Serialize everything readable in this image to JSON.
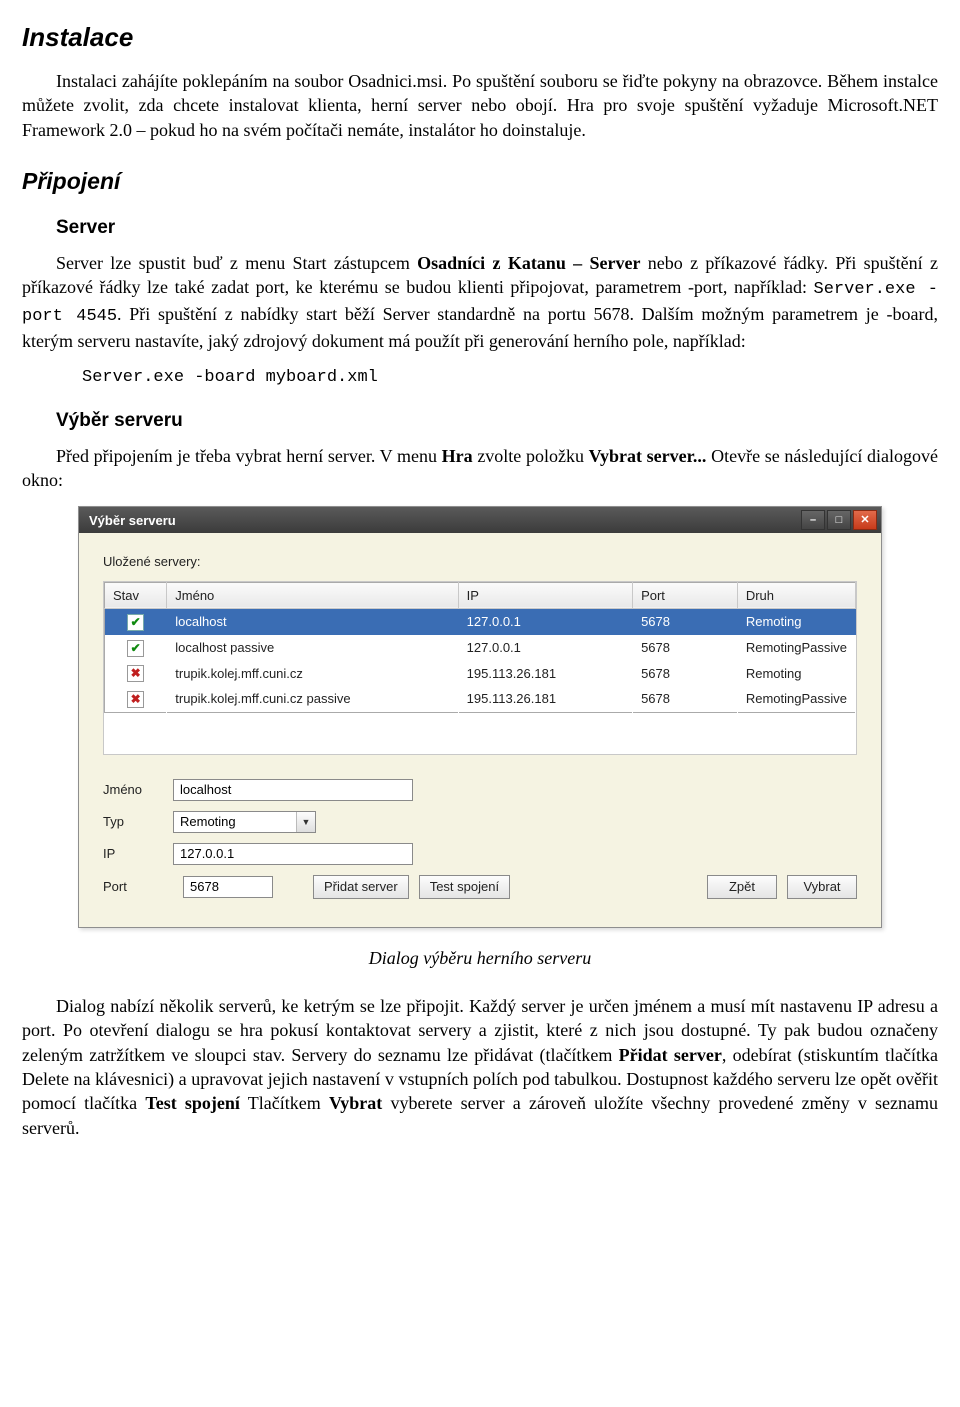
{
  "doc": {
    "h_instalace": "Instalace",
    "p_instalace_1a": "Instalaci zahájíte poklepáním na soubor Osadnici.msi. Po spuštění souboru se řiďte pokyny na obrazovce. Během instalce můžete zvolit, zda chcete instalovat klienta, herní server nebo obojí. Hra pro svoje spuštění vyžaduje Microsoft.NET Framework 2.0 – pokud ho na svém počítači nemáte, instalátor ho doinstaluje.",
    "h_pripojeni": "Připojení",
    "h_server": "Server",
    "p_server_1a": "Server lze spustit buď z menu Start zástupcem ",
    "p_server_bold1": "Osadníci z Katanu – Server",
    "p_server_1b": " nebo z příkazové řádky. Při spuštění z příkazové řádky lze také zadat port, ke kterému se budou klienti připojovat, parametrem -port, například: ",
    "p_server_code1": "Server.exe -port 4545",
    "p_server_1c": ". Při spuštění z nabídky start běží Server standardně na portu 5678. Dalším možným parametrem je -board, kterým serveru nastavíte, jaký zdrojový dokument má použít při generování herního pole, například:",
    "codeblock1": "Server.exe -board myboard.xml",
    "h_vyber": "Výběr serveru",
    "p_vyber_1a": "Před připojením je třeba vybrat herní server. V menu ",
    "p_vyber_bold1": "Hra",
    "p_vyber_1b": " zvolte položku ",
    "p_vyber_bold2": "Vybrat server...",
    "p_vyber_1c": " Otevře se následující dialogové okno:",
    "caption": "Dialog výběru herního serveru",
    "p_final_a": "Dialog nabízí několik serverů, ke ketrým se lze připojit. Každý server je určen jménem a musí mít nastavenu IP adresu a port. Po otevření dialogu se hra pokusí kontaktovat servery a zjistit, které z nich jsou dostupné. Ty pak budou označeny zeleným zatržítkem ve sloupci stav. Servery do seznamu lze přidávat (tlačítkem ",
    "p_final_bold1": "Přidat server",
    "p_final_b": ", odebírat (stiskuntím tlačítka Delete na klávesnici) a upravovat jejich nastavení v vstupních polích pod tabulkou. Dostupnost každého serveru lze opět ověřit pomocí tlačítka ",
    "p_final_bold2": "Test spojení",
    "p_final_c": " Tlačítkem ",
    "p_final_bold3": "Vybrat",
    "p_final_d": " vyberete server a zároveň uložíte všechny provedené změny v seznamu serverů."
  },
  "dialog": {
    "title": "Výběr serveru",
    "saved_label": "Uložené servery:",
    "columns": {
      "stav": "Stav",
      "jmeno": "Jméno",
      "ip": "IP",
      "port": "Port",
      "druh": "Druh"
    },
    "rows": [
      {
        "status": "ok",
        "jmeno": "localhost",
        "ip": "127.0.0.1",
        "port": "5678",
        "druh": "Remoting",
        "selected": true
      },
      {
        "status": "ok",
        "jmeno": "localhost passive",
        "ip": "127.0.0.1",
        "port": "5678",
        "druh": "RemotingPassive",
        "selected": false
      },
      {
        "status": "fail",
        "jmeno": "trupik.kolej.mff.cuni.cz",
        "ip": "195.113.26.181",
        "port": "5678",
        "druh": "Remoting",
        "selected": false
      },
      {
        "status": "fail",
        "jmeno": "trupik.kolej.mff.cuni.cz passive",
        "ip": "195.113.26.181",
        "port": "5678",
        "druh": "RemotingPassive",
        "selected": false
      }
    ],
    "form": {
      "jmeno_label": "Jméno",
      "jmeno_value": "localhost",
      "typ_label": "Typ",
      "typ_value": "Remoting",
      "ip_label": "IP",
      "ip_value": "127.0.0.1",
      "port_label": "Port",
      "port_value": "5678"
    },
    "buttons": {
      "add": "Přidat server",
      "test": "Test spojení",
      "back": "Zpět",
      "choose": "Vybrat"
    }
  }
}
